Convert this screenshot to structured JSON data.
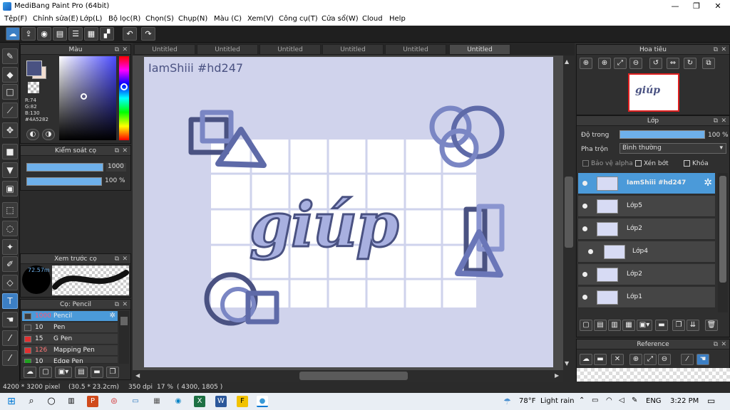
{
  "window": {
    "title": "MediBang Paint Pro (64bit)",
    "minimize": "—",
    "maximize": "❐",
    "close": "✕"
  },
  "menu": [
    "Tệp(F)",
    "Chỉnh sửa(E)",
    "Lớp(L)",
    "Bộ lọc(R)",
    "Chọn(S)",
    "Chụp(N)",
    "Màu (C)",
    "Xem(V)",
    "Công cụ(T)",
    "Cửa sổ(W)",
    "Cloud",
    "Help"
  ],
  "color_panel": {
    "title": "Màu",
    "r": "R:74",
    "g": "G:82",
    "b": "B:130",
    "hex": "#4A5282",
    "primary_color": "#4A5282",
    "secondary_color": "#f2ddd0"
  },
  "brush_control": {
    "title": "Kiểm soát cọ",
    "size_value": "1000",
    "opacity_value": "100 %"
  },
  "brush_preview": {
    "title": "Xem trước cọ",
    "size_label": "72.57m"
  },
  "brush_list": {
    "title": "Cọ: Pencil",
    "items": [
      {
        "size": "1000",
        "name": "Pencil",
        "color": "#3c3c3c"
      },
      {
        "size": "10",
        "name": "Pen",
        "color": "#3c3c3c"
      },
      {
        "size": "15",
        "name": "G Pen",
        "color": "#e03030"
      },
      {
        "size": "126",
        "name": "Mapping Pen",
        "color": "#e03030"
      },
      {
        "size": "10",
        "name": "Edge Pen",
        "color": "#20a020"
      }
    ]
  },
  "tabs": [
    "Untitled",
    "Untitled",
    "Untitled",
    "Untitled",
    "Untitled",
    "Untitled"
  ],
  "canvas": {
    "watermark": "IamShiii #hd247",
    "artwork_text": "giúp",
    "background": "#d0d3ec",
    "ink": "#4a5282"
  },
  "navigator": {
    "title": "Hoa tiêu"
  },
  "layer_panel": {
    "title": "Lớp",
    "opacity_label": "Độ trong",
    "opacity_value": "100 %",
    "blend_label": "Pha trộn",
    "blend_value": "Bình thường",
    "protect_alpha": "Bảo vệ alpha",
    "clipping": "Xén bớt",
    "lock": "Khóa",
    "layers": [
      {
        "name": "IamShiii #hd247",
        "selected": true
      },
      {
        "name": "Lớp5",
        "selected": false
      },
      {
        "name": "Lớp2",
        "selected": false
      },
      {
        "name": "Lớp4",
        "selected": false
      },
      {
        "name": "Lớp2",
        "selected": false
      },
      {
        "name": "Lớp1",
        "selected": false
      }
    ]
  },
  "reference": {
    "title": "Reference"
  },
  "status": {
    "size": "4200 * 3200 pixel",
    "physical": "(30.5 * 23.2cm)",
    "dpi": "350 dpi",
    "zoom": "17 %",
    "cursor": "( 4300, 1805 )"
  },
  "taskbar": {
    "weather_temp": "78°F",
    "weather_text": "Light rain",
    "lang": "ENG",
    "time": "3:22 PM"
  }
}
